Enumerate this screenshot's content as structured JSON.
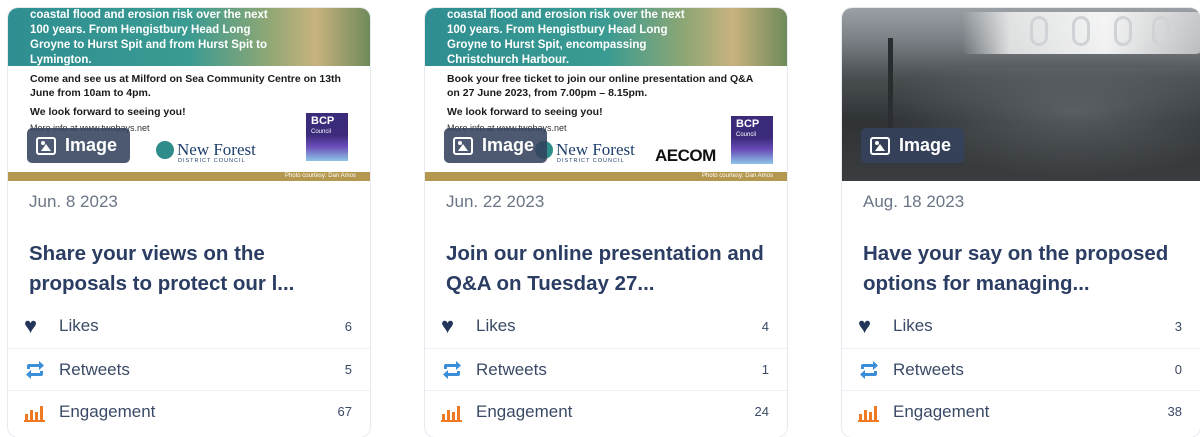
{
  "cards": [
    {
      "image_badge": "Image",
      "poster": {
        "aerial_text": "coastal flood and erosion risk over the next 100 years. From Hengistbury Head Long Groyne to Hurst Spit and from Hurst Spit to Lymington.",
        "line1": "Come and see us at Milford on Sea Community Centre on 13th June from 10am to 4pm.",
        "line2": "We look forward to seeing you!",
        "more": "More info at www.twobays.net",
        "credit": "Photo courtesy: Dan Amos"
      },
      "date": "Jun. 8 2023",
      "title": "Share your views on the proposals to protect our l...",
      "stats": {
        "likes_label": "Likes",
        "likes": "6",
        "retweets_label": "Retweets",
        "retweets": "5",
        "engagement_label": "Engagement",
        "engagement": "67"
      }
    },
    {
      "image_badge": "Image",
      "poster": {
        "aerial_text": "coastal flood and erosion risk over the next 100 years. From Hengistbury Head Long Groyne to Hurst Spit, encompassing Christchurch Harbour.",
        "line1": "Book your free ticket to join our online presentation and Q&A on 27 June 2023, from 7.00pm – 8.15pm.",
        "line2": "We look forward to seeing you!",
        "more": "More info at www.twobays.net",
        "credit": "Photo courtesy: Dan Amos"
      },
      "date": "Jun. 22 2023",
      "title": "Join our online presentation and Q&A on Tuesday 27...",
      "stats": {
        "likes_label": "Likes",
        "likes": "4",
        "retweets_label": "Retweets",
        "retweets": "1",
        "engagement_label": "Engagement",
        "engagement": "24"
      }
    },
    {
      "image_badge": "Image",
      "date": "Aug. 18 2023",
      "title": "Have your say on the proposed options for managing...",
      "stats": {
        "likes_label": "Likes",
        "likes": "3",
        "retweets_label": "Retweets",
        "retweets": "0",
        "engagement_label": "Engagement",
        "engagement": "38"
      }
    }
  ],
  "logos": {
    "new_forest": "New Forest",
    "new_forest_sub": "DISTRICT COUNCIL",
    "bcp": "BCP",
    "bcp_sub": "Council",
    "aecom": "AECOM"
  },
  "colors": {
    "title": "#2b3d63",
    "badge_bg": "#34425c",
    "heart": "#24355a",
    "retweet": "#3b8fd8",
    "engagement": "#f07a22",
    "poster_strip": "#b5984f"
  }
}
